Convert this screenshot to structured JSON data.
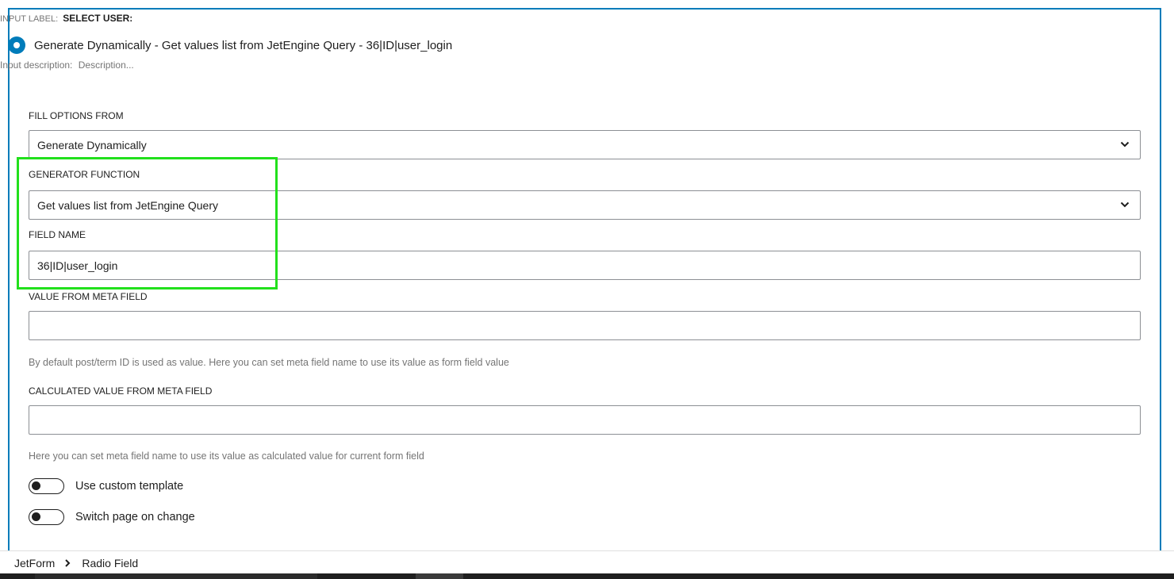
{
  "header": {
    "input_label_prefix": "INPUT LABEL:",
    "input_label_value": "SELECT USER:",
    "radio_option_text": "Generate Dynamically - Get values list from JetEngine Query - 36|ID|user_login",
    "input_description_prefix": "Input description:",
    "input_description_value": "Description..."
  },
  "fields": {
    "fill_options_label": "FILL OPTIONS FROM",
    "fill_options_value": "Generate Dynamically",
    "generator_label": "GENERATOR FUNCTION",
    "generator_value": "Get values list from JetEngine Query",
    "field_name_label": "FIELD NAME",
    "field_name_value": "36|ID|user_login",
    "value_meta_label": "VALUE FROM META FIELD",
    "value_meta_value": "",
    "value_meta_help": "By default post/term ID is used as value. Here you can set meta field name to use its value as form field value",
    "calc_meta_label": "CALCULATED VALUE FROM META FIELD",
    "calc_meta_value": "",
    "calc_meta_help": "Here you can set meta field name to use its value as calculated value for current form field"
  },
  "toggles": [
    {
      "label": "Use custom template",
      "on": false
    },
    {
      "label": "Switch page on change",
      "on": false
    }
  ],
  "breadcrumb": {
    "items": [
      "JetForm",
      "Radio Field"
    ]
  },
  "colors": {
    "accent": "#007cba",
    "highlight": "#22e01c",
    "help_text": "#757575"
  },
  "icons": {
    "select_arrow": "chevron-down-icon",
    "breadcrumb_separator": "chevron-right-icon"
  }
}
